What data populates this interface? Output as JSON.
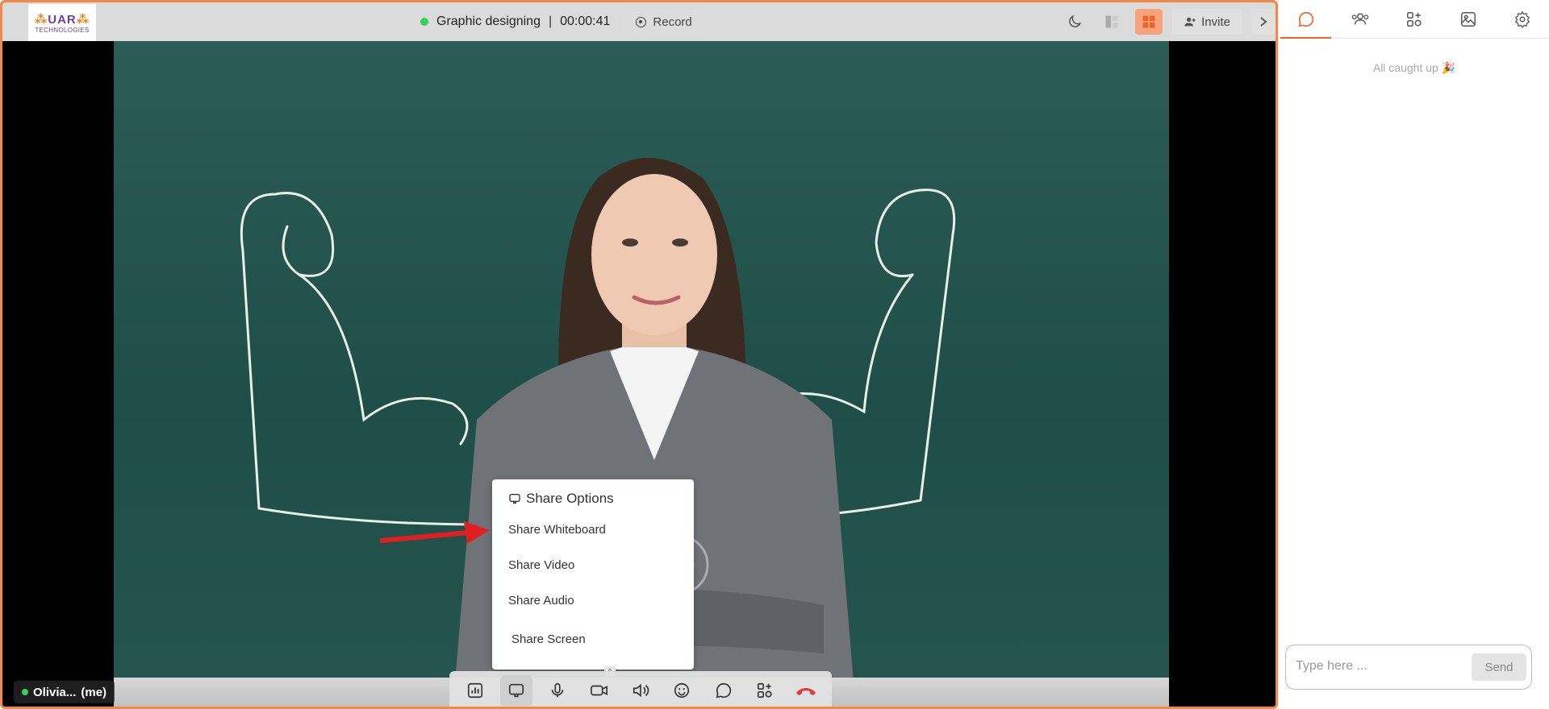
{
  "app": {
    "logo_text": "UAR",
    "logo_sub": "TECHNOLOGIES"
  },
  "session": {
    "title": "Graphic designing",
    "separator": "|",
    "timer": "00:00:41",
    "record_label": "Record"
  },
  "topbar": {
    "invite_label": "Invite"
  },
  "participant": {
    "name": "Olivia...",
    "suffix": "(me)"
  },
  "share_menu": {
    "title": "Share Options",
    "items": [
      "Share Whiteboard",
      "Share Video",
      "Share Audio",
      "Share Screen"
    ]
  },
  "panel": {
    "tabs": [
      "chat-icon",
      "participants-icon",
      "apps-icon",
      "gallery-icon",
      "settings-icon"
    ],
    "status": "All caught up 🎉",
    "input_placeholder": "Type here ...",
    "send_label": "Send"
  },
  "toolbar": {
    "tools": [
      "poll-icon",
      "share-icon",
      "mic-icon",
      "camera-icon",
      "speaker-icon",
      "emoji-icon",
      "chat-icon",
      "apps-icon",
      "end-call-icon"
    ]
  },
  "colors": {
    "accent": "#f0622a",
    "frame": "#f08a4b",
    "live": "#2fd35b",
    "end_call": "#e53935"
  }
}
